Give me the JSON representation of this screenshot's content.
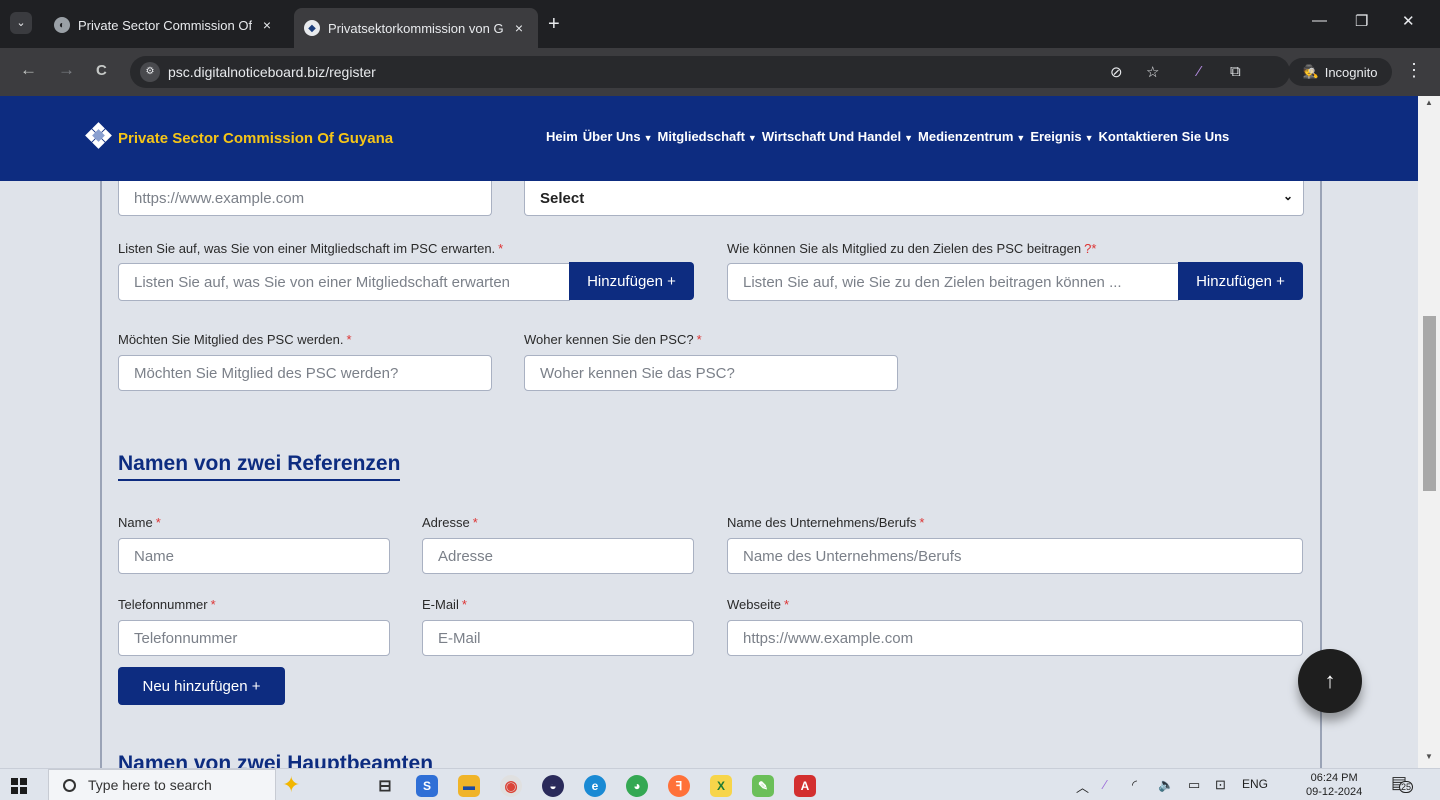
{
  "browser": {
    "tabs": [
      {
        "title": "Private Sector Commission Of G",
        "close": "×"
      },
      {
        "title": "Privatsektorkommission von Gu",
        "close": "×"
      }
    ],
    "new_tab": "+",
    "window_controls": {
      "minimize": "—",
      "restore": "❐",
      "close": "✕"
    },
    "nav": {
      "back": "←",
      "forward": "→",
      "reload": "C"
    },
    "url": "psc.digitalnoticeboard.biz/register",
    "incognito_label": "Incognito",
    "menu": "⋮"
  },
  "site": {
    "logo_text": "Private Sector Commission Of Guyana",
    "nav": [
      {
        "label": "Heim",
        "has_dropdown": false
      },
      {
        "label": "Über Uns",
        "has_dropdown": true
      },
      {
        "label": "Mitgliedschaft",
        "has_dropdown": true
      },
      {
        "label": "Wirtschaft Und Handel",
        "has_dropdown": true
      },
      {
        "label": "Medienzentrum",
        "has_dropdown": true
      },
      {
        "label": "Ereignis",
        "has_dropdown": true
      },
      {
        "label": "Kontaktieren Sie Uns",
        "has_dropdown": false
      }
    ],
    "chevron": "▼"
  },
  "form": {
    "website_top": {
      "placeholder": "https://www.example.com"
    },
    "select_top": {
      "value": "Select",
      "chevron": "⌄"
    },
    "expect": {
      "label": "Listen Sie auf, was Sie von einer Mitgliedschaft im PSC erwarten.",
      "required": "*",
      "placeholder": "Listen Sie auf, was Sie von einer Mitgliedschaft erwarten",
      "button": "Hinzufügen +"
    },
    "contribute": {
      "label": "Wie können Sie als Mitglied zu den Zielen des PSC beitragen",
      "qmark": "?",
      "required": "*",
      "placeholder": "Listen Sie auf, wie Sie zu den Zielen beitragen können ...",
      "button": "Hinzufügen +"
    },
    "become_member": {
      "label": "Möchten Sie Mitglied des PSC werden.",
      "required": "*",
      "placeholder": "Möchten Sie Mitglied des PSC werden?"
    },
    "how_know": {
      "label": "Woher kennen Sie den PSC?",
      "required": "*",
      "placeholder": "Woher kennen Sie das PSC?"
    },
    "references": {
      "title": "Namen von zwei Referenzen",
      "name": {
        "label": "Name",
        "required": "*",
        "placeholder": "Name"
      },
      "address": {
        "label": "Adresse",
        "required": "*",
        "placeholder": "Adresse"
      },
      "company": {
        "label": "Name des Unternehmens/Berufs",
        "required": "*",
        "placeholder": "Name des Unternehmens/Berufs"
      },
      "phone": {
        "label": "Telefonnummer",
        "required": "*",
        "placeholder": "Telefonnummer"
      },
      "email": {
        "label": "E-Mail",
        "required": "*",
        "placeholder": "E-Mail"
      },
      "website": {
        "label": "Webseite",
        "required": "*",
        "placeholder": "https://www.example.com"
      },
      "add_new": "Neu hinzufügen +"
    },
    "next_section_title": "Namen von zwei Hauptbeamten",
    "scroll_top": "↑"
  },
  "taskbar": {
    "search_placeholder": "Type here to search",
    "tray_lang": "ENG",
    "time": "06:24 PM",
    "date": "09-12-2024",
    "notification_count": "25"
  }
}
